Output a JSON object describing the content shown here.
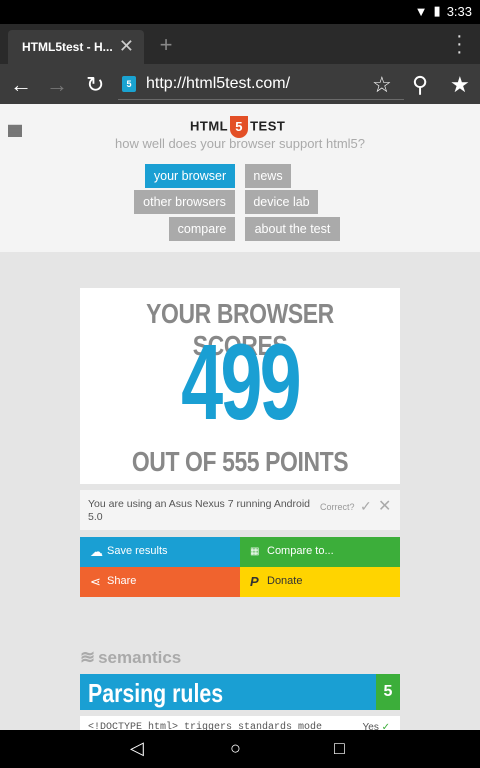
{
  "status": {
    "time": "3:33"
  },
  "tab": {
    "title": "HTML5test - H...",
    "close": "✕"
  },
  "newtab": "+",
  "toolbar": {
    "url": "http://html5test.com/",
    "badge": "5"
  },
  "site": {
    "logo_left": "HTML",
    "logo_num": "5",
    "logo_right": "TEST",
    "tagline": "how well does your browser support html5?"
  },
  "nav": {
    "your_browser": "your browser",
    "news": "news",
    "other_browsers": "other browsers",
    "device_lab": "device lab",
    "compare": "compare",
    "about": "about the test"
  },
  "score": {
    "heading": "YOUR BROWSER SCORES",
    "value": "499",
    "out_of": "OUT OF 555 POINTS"
  },
  "device": {
    "text": "You are using an Asus Nexus 7 running Android 5.0",
    "correct": "Correct?"
  },
  "actions": {
    "save": "Save results",
    "compare": "Compare to...",
    "share": "Share",
    "donate": "Donate"
  },
  "colors": {
    "save": "#1a9fd3",
    "compare": "#3cae3a",
    "share": "#f0632e",
    "donate": "#ffd400"
  },
  "section": {
    "name": "semantics"
  },
  "parsing": {
    "title": "Parsing rules",
    "score": "5"
  },
  "row1": {
    "text": "<!DOCTYPE html> triggers standards mode",
    "result": "Yes"
  }
}
